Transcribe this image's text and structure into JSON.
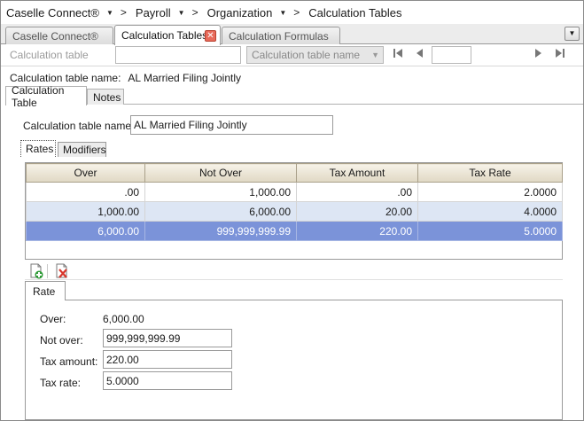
{
  "breadcrumb": {
    "items": [
      "Caselle Connect®",
      "Payroll",
      "Organization",
      "Calculation Tables"
    ]
  },
  "tabs": [
    {
      "label": "Caselle Connect®",
      "active": false
    },
    {
      "label": "Calculation Tables",
      "active": true
    },
    {
      "label": "Calculation Formulas",
      "active": false
    }
  ],
  "toolbar": {
    "calc_table_label": "Calculation table",
    "calc_table_value": "",
    "select_placeholder": "Calculation table name",
    "page_value": ""
  },
  "header": {
    "name_label": "Calculation table name:",
    "name_value": "AL Married Filing Jointly"
  },
  "subtabs": [
    "Calculation Table",
    "Notes"
  ],
  "form": {
    "name_label": "Calculation table name:",
    "name_value": "AL Married Filing Jointly"
  },
  "rate_tabs": [
    "Rates",
    "Modifiers"
  ],
  "grid": {
    "columns": [
      "Over",
      "Not Over",
      "Tax Amount",
      "Tax Rate"
    ],
    "rows": [
      [
        ".00",
        "1,000.00",
        ".00",
        "2.0000"
      ],
      [
        "1,000.00",
        "6,000.00",
        "20.00",
        "4.0000"
      ],
      [
        "6,000.00",
        "999,999,999.99",
        "220.00",
        "5.0000"
      ]
    ],
    "selected_row": 2
  },
  "detail": {
    "tab_label": "Rate",
    "over_label": "Over:",
    "over_value": "6,000.00",
    "not_over_label": "Not over:",
    "not_over_value": "999,999,999.99",
    "tax_amount_label": "Tax amount:",
    "tax_amount_value": "220.00",
    "tax_rate_label": "Tax rate:",
    "tax_rate_value": "5.0000"
  },
  "colors": {
    "selected_row": "#7b93d9",
    "alt_row": "#dde6f4",
    "header_bg": "#e0d8c4",
    "close_tab": "#e86a5a"
  }
}
